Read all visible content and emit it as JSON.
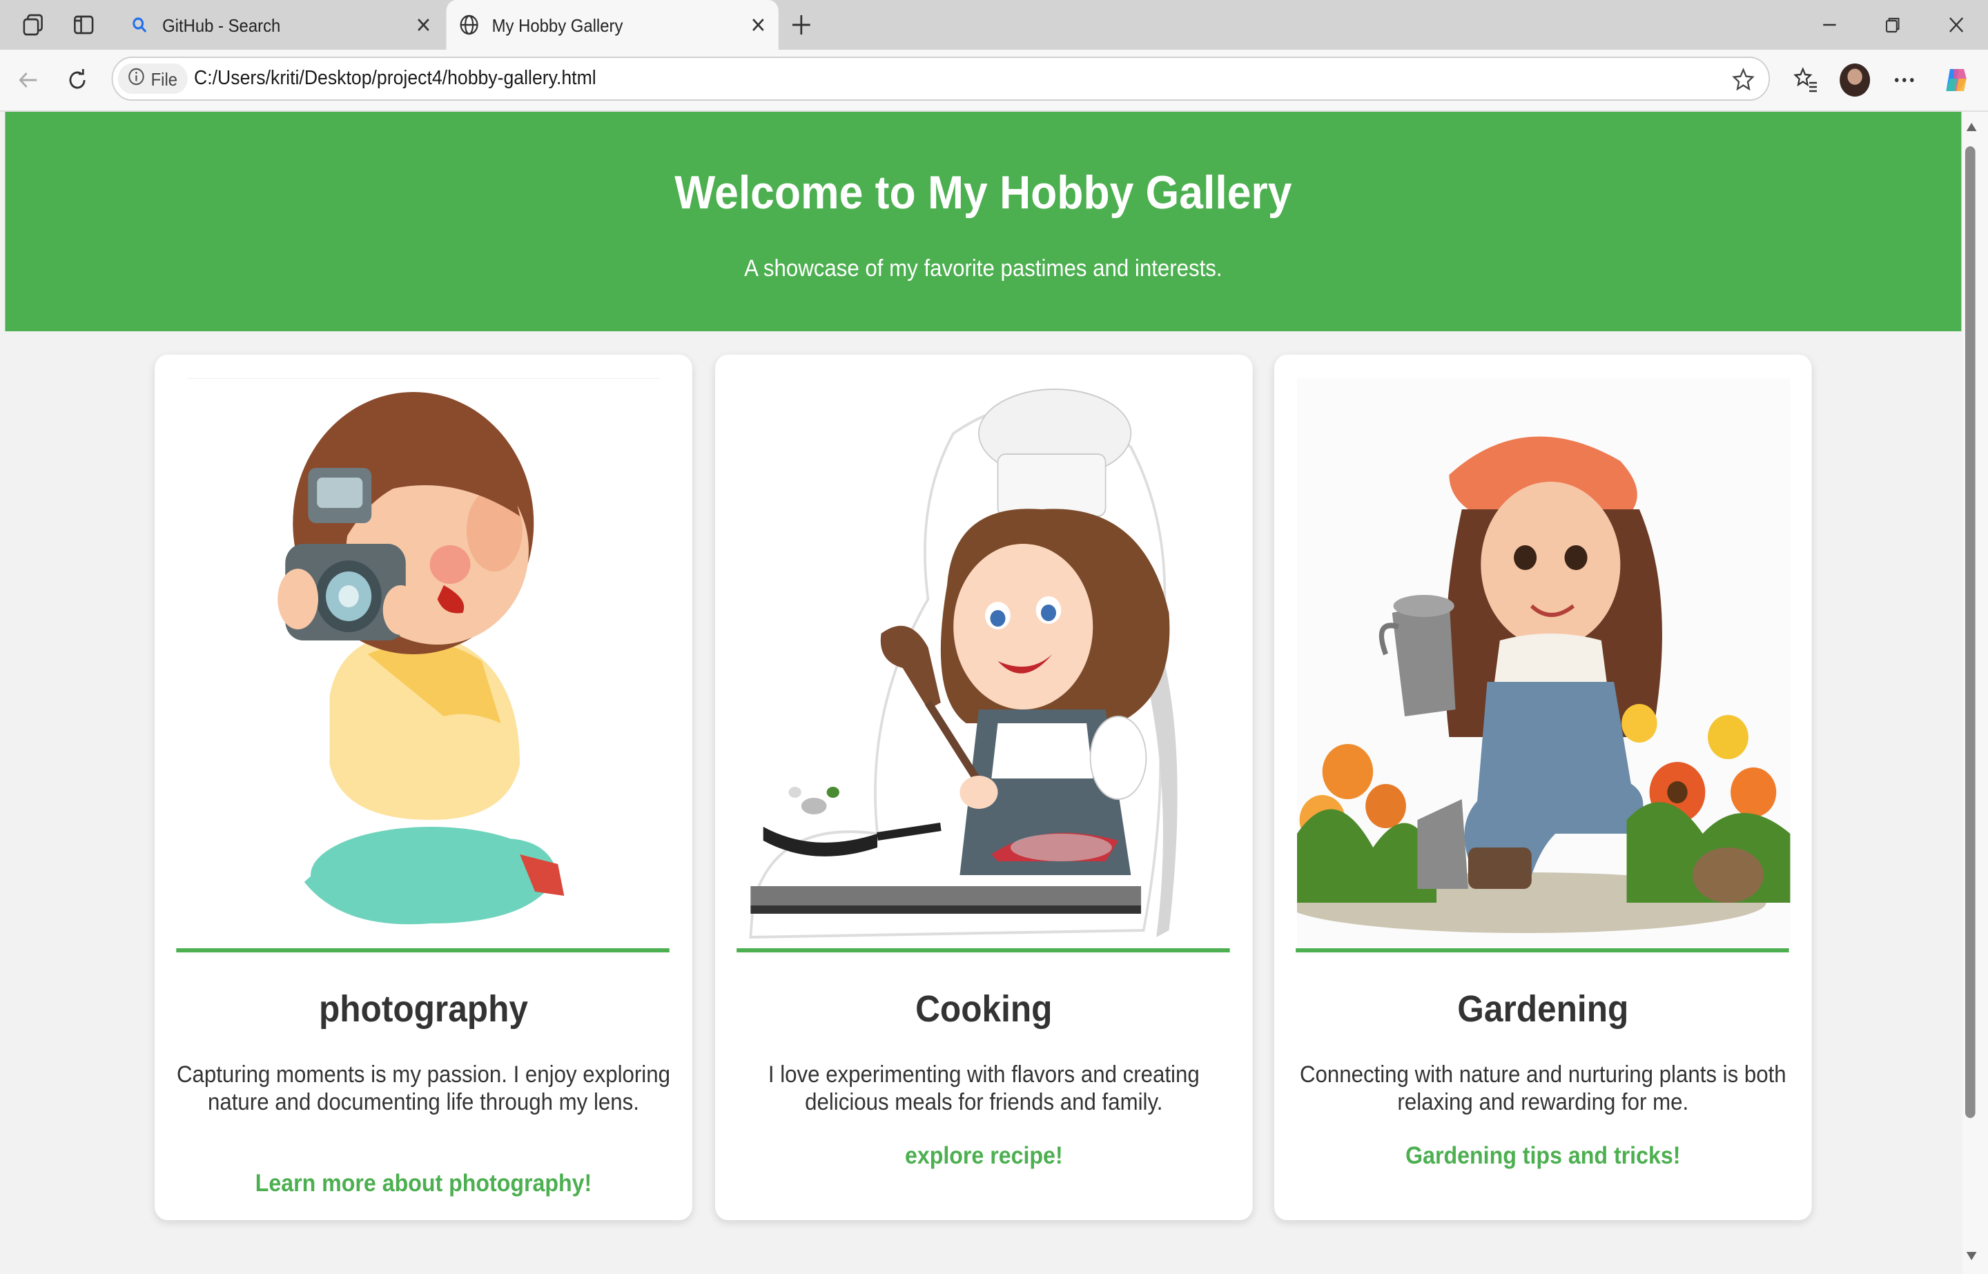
{
  "browser": {
    "tabs": [
      {
        "title": "GitHub - Search",
        "icon": "search-icon",
        "active": false
      },
      {
        "title": "My Hobby Gallery",
        "icon": "globe-icon",
        "active": true
      }
    ],
    "address": {
      "scheme_label": "File",
      "url": "C:/Users/kriti/Desktop/project4/hobby-gallery.html"
    }
  },
  "hero": {
    "title": "Welcome to My Hobby Gallery",
    "subtitle": "A showcase of my favorite pastimes and interests."
  },
  "cards": [
    {
      "title": "photography",
      "description": "Capturing moments is my passion. I enjoy exploring nature and documenting life through my lens.",
      "link": "Learn more about photography!",
      "image": "girl-with-camera-illustration"
    },
    {
      "title": "Cooking",
      "description": "I love experimenting with flavors and creating delicious meals for friends and family.",
      "link": "explore recipe!",
      "image": "chef-girl-illustration"
    },
    {
      "title": "Gardening",
      "description": "Connecting with nature and nurturing plants is both relaxing and rewarding for me.",
      "link": "Gardening tips and tricks!",
      "image": "gardener-girl-illustration"
    }
  ],
  "colors": {
    "accent": "#4caf50",
    "page_bg": "#f2f2f2",
    "text": "#333333"
  }
}
